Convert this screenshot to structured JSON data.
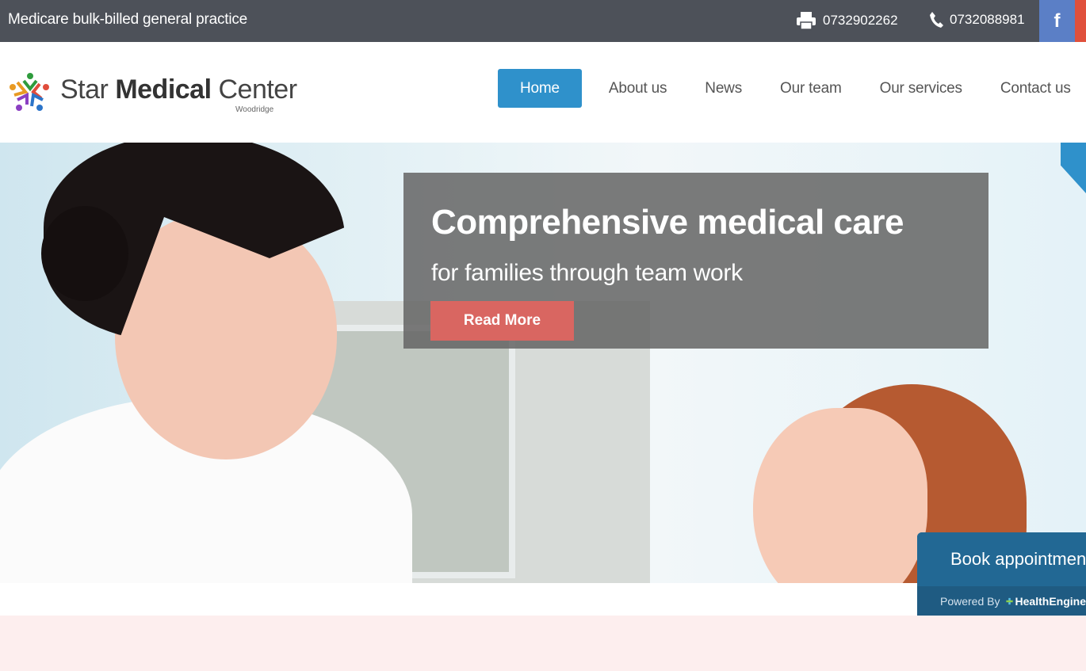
{
  "topbar": {
    "tagline": "Medicare bulk-billed general practice",
    "fax": "0732902262",
    "phone": "0732088981",
    "facebook_glyph": "f",
    "icons": {
      "fax": "printer-icon",
      "phone": "phone-icon",
      "facebook": "facebook-icon"
    }
  },
  "logo": {
    "name_regular": "Star ",
    "name_bold": "Medical",
    "name_end": " Center",
    "subtitle": "Woodridge"
  },
  "nav": {
    "items": [
      {
        "label": "Home",
        "active": true
      },
      {
        "label": "About us"
      },
      {
        "label": "News"
      },
      {
        "label": "Our team"
      },
      {
        "label": "Our services"
      },
      {
        "label": "Contact us"
      }
    ]
  },
  "hero": {
    "title": "Comprehensive medical care",
    "subtitle": "for families through team work",
    "cta": "Read More"
  },
  "booking": {
    "label": "Book appointment",
    "powered_by": "Powered By",
    "provider": "HealthEngine",
    "icon": "calendar-clock-icon"
  },
  "colors": {
    "topbar": "#4d5159",
    "accent": "#2f91cb",
    "cta": "#d96661",
    "booking": "#226894",
    "facebook": "#5b7fc6"
  }
}
